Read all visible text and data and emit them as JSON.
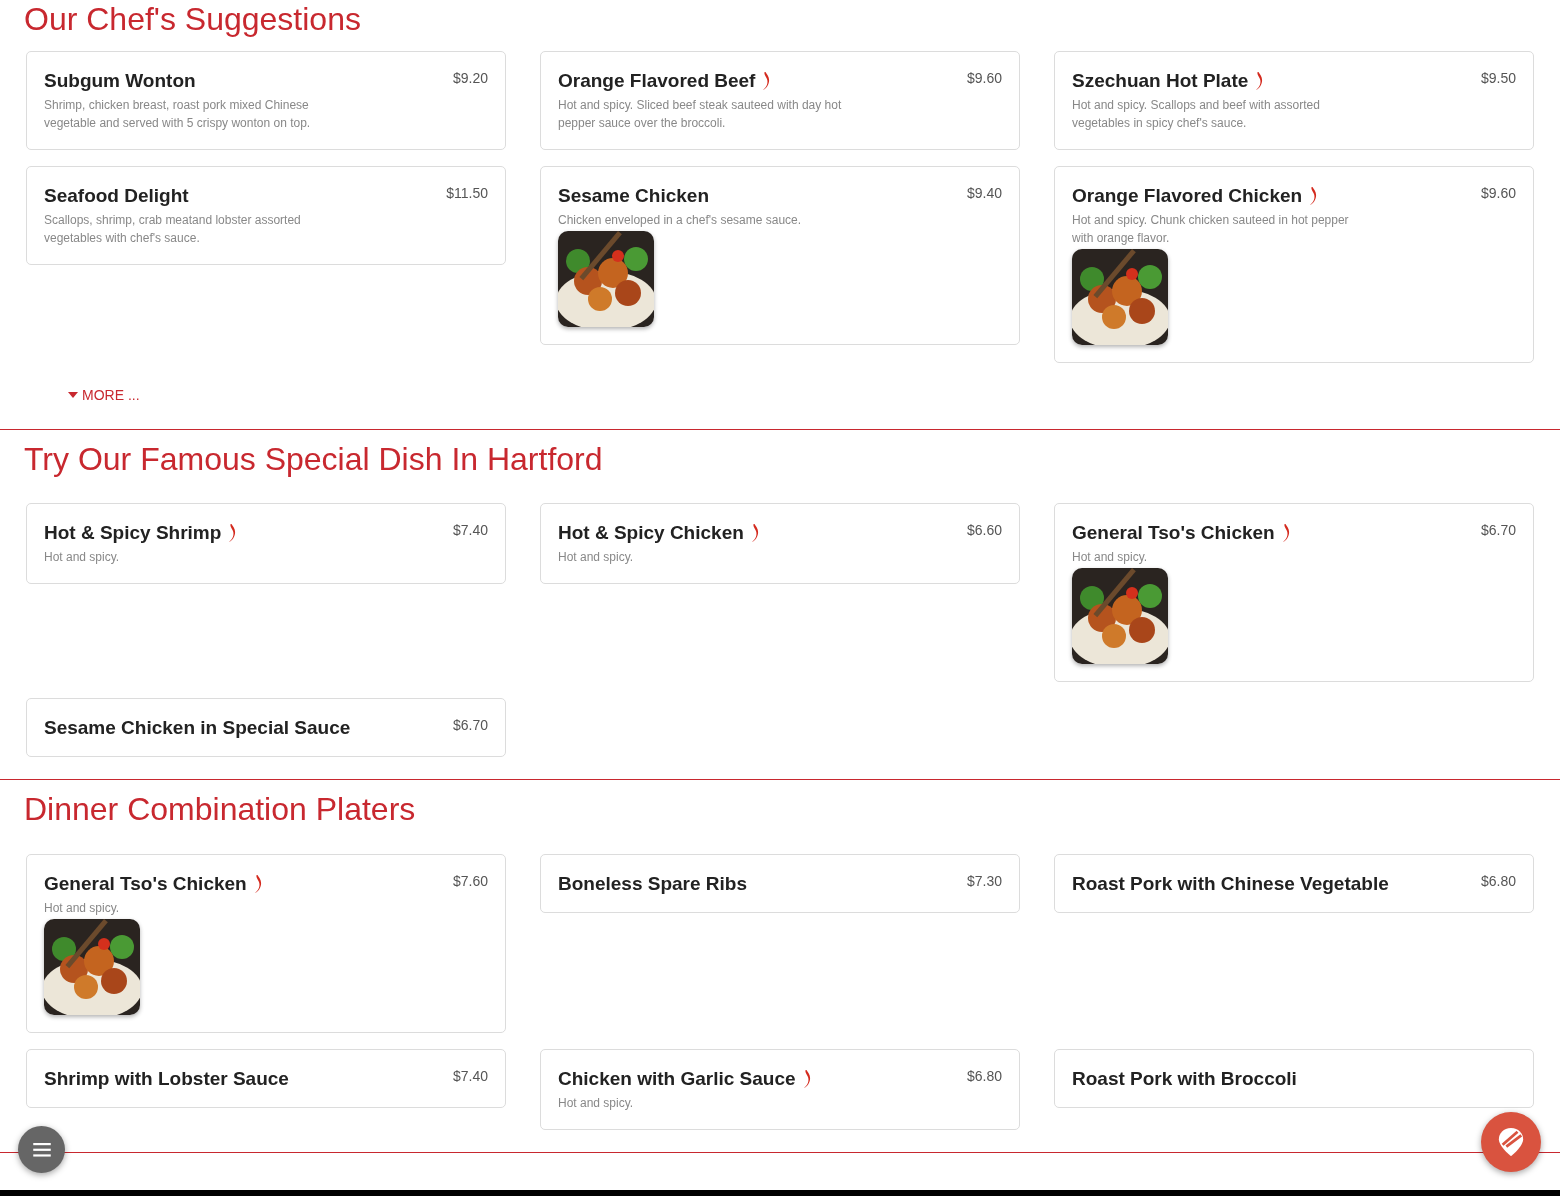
{
  "sections": [
    {
      "title": "Our Chef's Suggestions",
      "more": "MORE ...",
      "items": [
        {
          "name": "Subgum Wonton",
          "price": "$9.20",
          "spicy": false,
          "description": "Shrimp, chicken breast, roast pork mixed Chinese vegetable and served with 5 crispy wonton on top.",
          "photo": false
        },
        {
          "name": "Orange Flavored Beef",
          "price": "$9.60",
          "spicy": true,
          "description": "Hot and spicy. Sliced beef steak sauteed with day hot pepper sauce over the broccoli.",
          "photo": false
        },
        {
          "name": "Szechuan Hot Plate",
          "price": "$9.50",
          "spicy": true,
          "description": "Hot and spicy. Scallops and beef with assorted vegetables in spicy chef's sauce.",
          "photo": false
        },
        {
          "name": "Seafood Delight",
          "price": "$11.50",
          "spicy": false,
          "description": "Scallops, shrimp, crab meatand lobster assorted vegetables with chef's sauce.",
          "photo": false
        },
        {
          "name": "Sesame Chicken",
          "price": "$9.40",
          "spicy": false,
          "description": "Chicken enveloped in a chef's sesame sauce.",
          "photo": true
        },
        {
          "name": "Orange Flavored Chicken",
          "price": "$9.60",
          "spicy": true,
          "description": "Hot and spicy. Chunk chicken sauteed in hot pepper with orange flavor.",
          "photo": true
        }
      ]
    },
    {
      "title": "Try Our Famous Special Dish In Hartford",
      "items": [
        {
          "name": "Hot & Spicy Shrimp",
          "price": "$7.40",
          "spicy": true,
          "description": "Hot and spicy.",
          "photo": false
        },
        {
          "name": "Hot & Spicy Chicken",
          "price": "$6.60",
          "spicy": true,
          "description": "Hot and spicy.",
          "photo": false
        },
        {
          "name": "General Tso's Chicken",
          "price": "$6.70",
          "spicy": true,
          "description": "Hot and spicy.",
          "photo": true
        },
        {
          "name": "Sesame Chicken in Special Sauce",
          "price": "$6.70",
          "spicy": false,
          "photo": false
        }
      ]
    },
    {
      "title": "Dinner Combination Platers",
      "items": [
        {
          "name": "General Tso's Chicken",
          "price": "$7.60",
          "spicy": true,
          "description": "Hot and spicy.",
          "photo": true
        },
        {
          "name": "Boneless Spare Ribs",
          "price": "$7.30",
          "spicy": false,
          "photo": false
        },
        {
          "name": "Roast Pork with Chinese Vegetable",
          "price": "$6.80",
          "spicy": false,
          "photo": false
        },
        {
          "name": "Shrimp with Lobster Sauce",
          "price": "$7.40",
          "spicy": false,
          "photo": false
        },
        {
          "name": "Chicken with Garlic Sauce",
          "price": "$6.80",
          "spicy": true,
          "description": "Hot and spicy.",
          "photo": false
        },
        {
          "name": "Roast Pork with Broccoli",
          "spicy": false,
          "photo": false
        }
      ]
    }
  ]
}
